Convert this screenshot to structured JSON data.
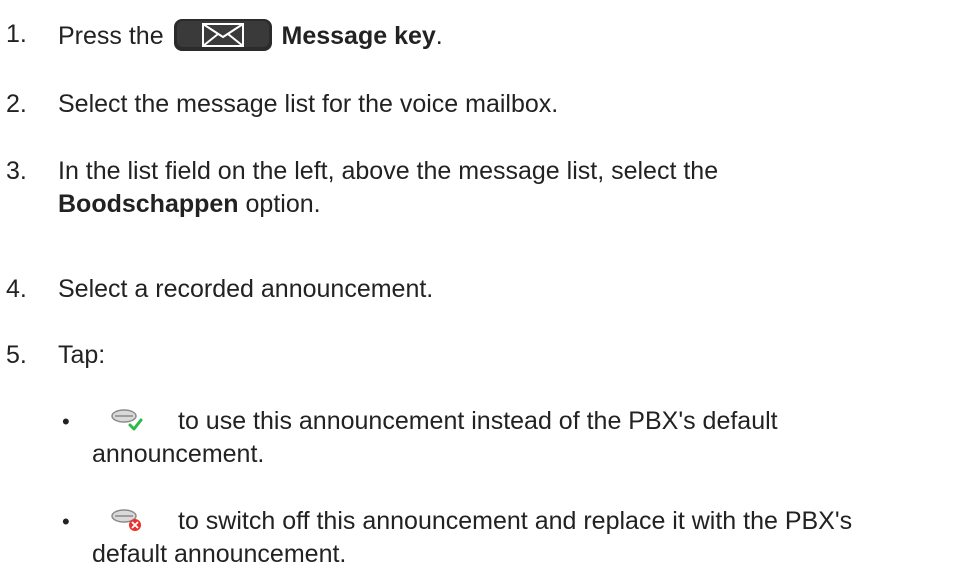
{
  "steps": [
    {
      "num": "1.",
      "prefix": "Press the",
      "bold": "Message key",
      "suffix": ".",
      "icon": "envelope-key-icon"
    },
    {
      "num": "2.",
      "text": "Select the message list for the voice mailbox."
    },
    {
      "num": "3.",
      "line1": "In the list field on the left, above the message list, select the",
      "bold": "Boodschappen",
      "line2_suffix": " option."
    },
    {
      "num": "4.",
      "text": "Select a recorded announcement."
    },
    {
      "num": "5.",
      "text": "Tap:"
    }
  ],
  "bullets": [
    {
      "marker": "•",
      "icon": "announcement-activate-icon",
      "line1": "to use this announcement instead of the PBX's default",
      "line2": "announcement."
    },
    {
      "marker": "•",
      "icon": "announcement-deactivate-icon",
      "line1": "to switch off this announcement and replace it with the PBX's",
      "line2": "default announcement."
    }
  ],
  "colors": {
    "text": "#222222",
    "check": "#2fb84a",
    "cross": "#e8312f",
    "key": "#2b2b2b"
  }
}
